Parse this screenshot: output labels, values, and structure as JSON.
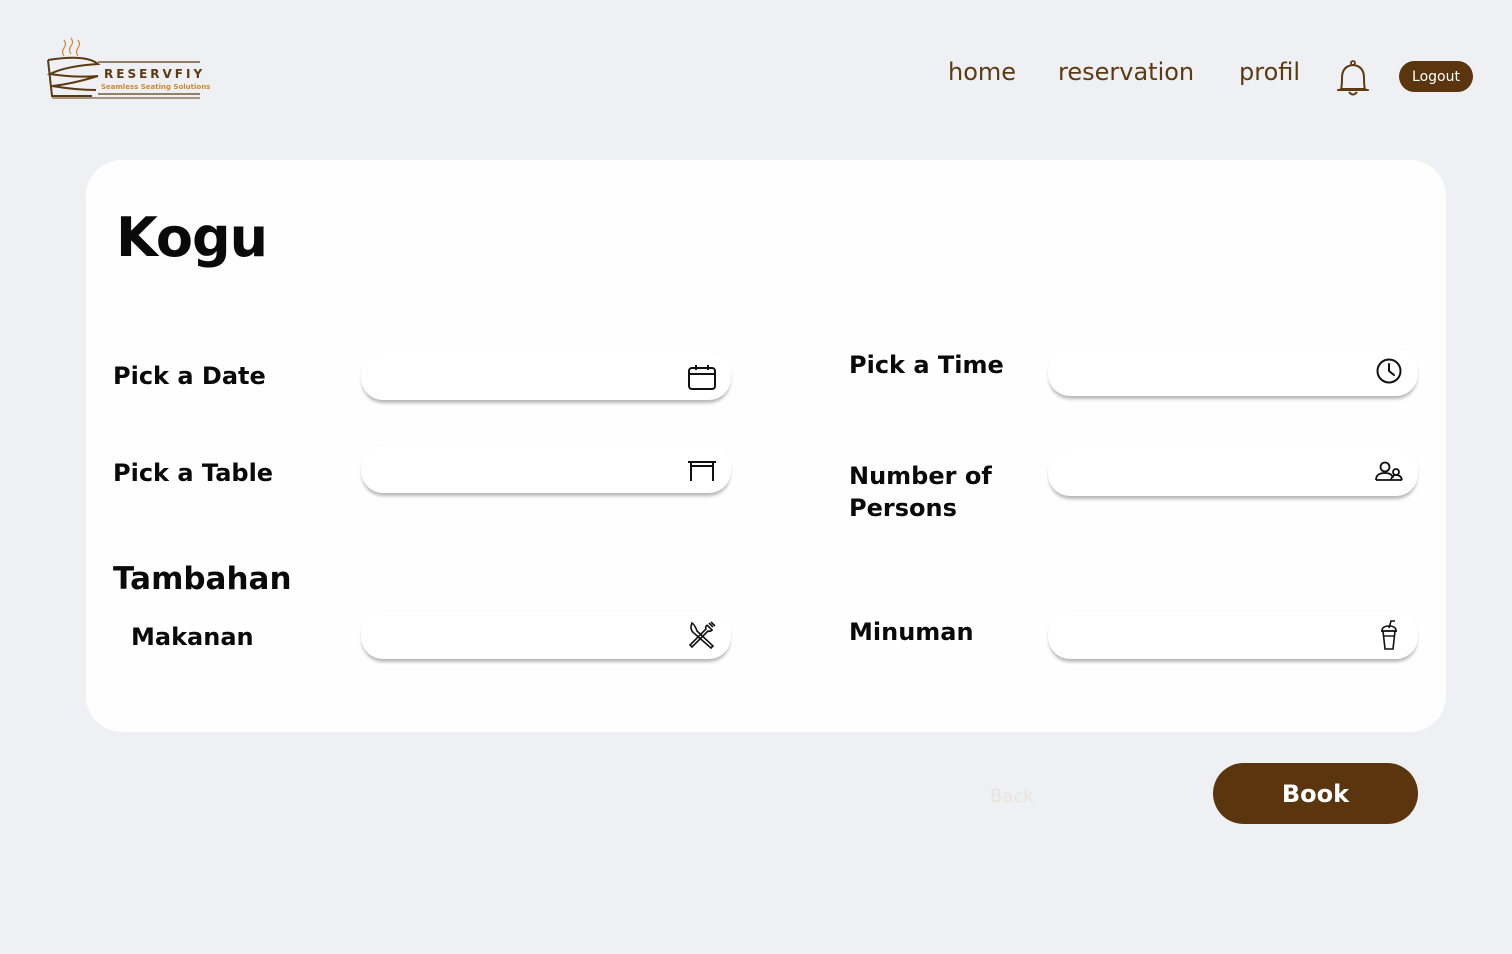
{
  "brand": {
    "name": "RESERVFIY",
    "tagline": "Seamless Seating Solutions",
    "logo_icon": "steaming-cup-icon"
  },
  "nav": {
    "home": "home",
    "reservation": "reservation",
    "profil": "profil",
    "notification_icon": "bell-icon",
    "logout": "Logout"
  },
  "colors": {
    "brand_brown": "#5a350d",
    "page_bg": "#eff0f3",
    "card_bg": "#fefefe"
  },
  "form": {
    "restaurant_name": "Kogu",
    "date": {
      "label": "Pick a Date",
      "value": "",
      "icon": "calendar-icon"
    },
    "time": {
      "label": "Pick a Time",
      "value": "",
      "icon": "clock-icon"
    },
    "table": {
      "label": "Pick a Table",
      "value": "",
      "icon": "table-icon"
    },
    "persons": {
      "label_line1": "Number of",
      "label_line2": "Persons",
      "value": "",
      "icon": "people-icon"
    },
    "extras_title": "Tambahan",
    "food": {
      "label": "Makanan",
      "value": "",
      "icon": "fork-knife-icon"
    },
    "drink": {
      "label": "Minuman",
      "value": "",
      "icon": "drink-cup-icon"
    }
  },
  "actions": {
    "back": "Back",
    "book": "Book"
  }
}
